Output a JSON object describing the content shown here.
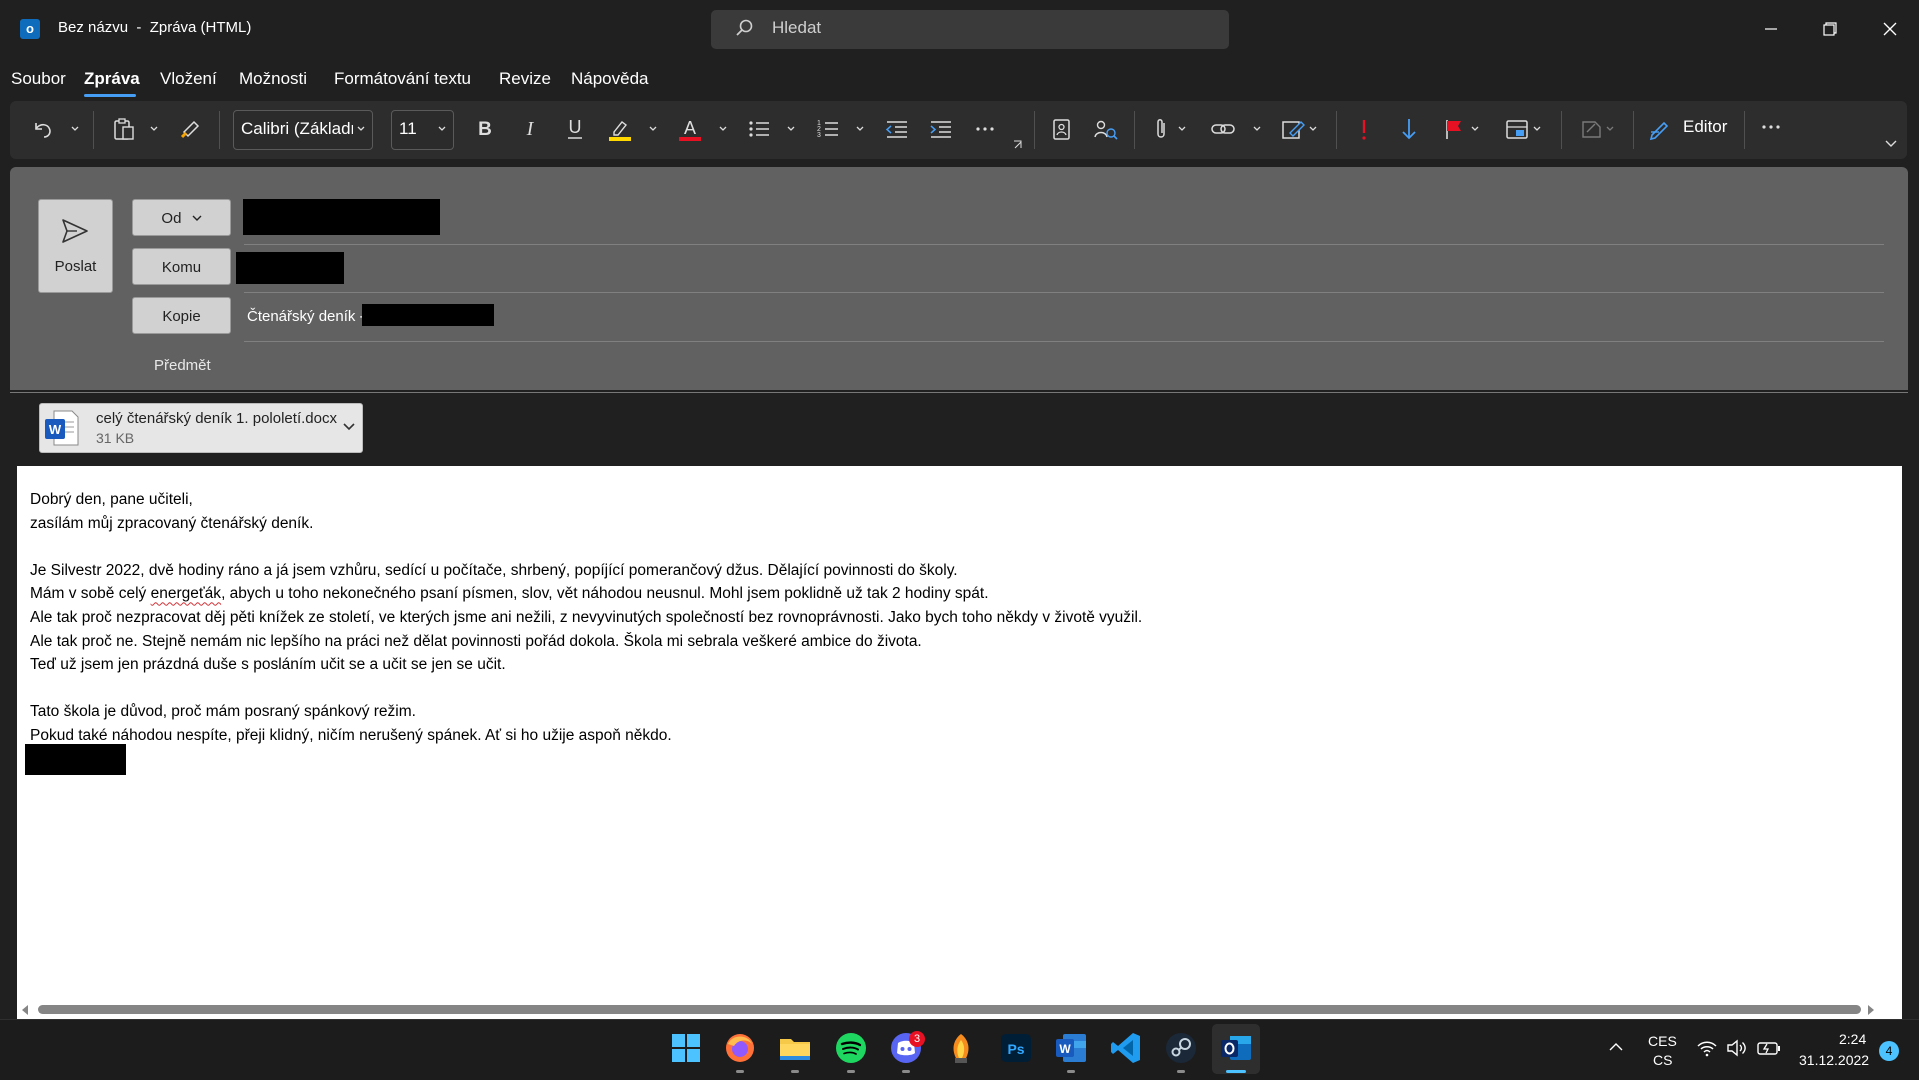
{
  "window": {
    "title": "Bez názvu  -  Zpráva (HTML)",
    "search_placeholder": "Hledat"
  },
  "tabs": [
    "Soubor",
    "Zpráva",
    "Vložení",
    "Možnosti",
    "Formátování textu",
    "Revize",
    "Nápověda"
  ],
  "active_tab": "Zpráva",
  "ribbon": {
    "font_name": "Calibri (Základní",
    "font_size": "11",
    "editor_label": "Editor",
    "highlight_color": "#ffd800",
    "font_color": "#e81123",
    "importance_high_color": "#e81123",
    "importance_low_color": "#479ef5",
    "flag_color": "#e81123"
  },
  "compose": {
    "send_label": "Poslat",
    "from_label": "Od",
    "to_label": "Komu",
    "cc_label": "Kopie",
    "cc_text": "Čtenářský deník - ",
    "subject_label": "Předmět"
  },
  "attachment": {
    "name": "celý čtenářský deník 1. pololetí.docx",
    "size": "31 KB"
  },
  "body": {
    "line1": "Dobrý den, pane učiteli,",
    "line2": "zasílám můj zpracovaný čtenářský deník.",
    "line3": "Je Silvestr 2022, dvě hodiny ráno a já jsem vzhůru, sedící u počítače, shrbený, popíjící pomerančový džus. Dělající povinnosti do školy.",
    "line4a": "Mám v sobě celý ",
    "line4b": "energeťák",
    "line4c": ", abych u toho nekonečného psaní písmen, slov, vět náhodou neusnul. Mohl jsem poklidně už tak 2 hodiny spát.",
    "line5": "Ale tak proč nezpracovat děj pěti knížek ze století, ve kterých jsme ani nežili, z nevyvinutých společností bez rovnoprávnosti. Jako bych toho někdy v životě využil.",
    "line6": "Ale tak proč ne. Stejně nemám nic lepšího na práci než dělat povinnosti pořád dokola. Škola mi sebrala veškeré ambice do života.",
    "line7": "Teď už jsem jen prázdná duše s posláním učit se a učit se jen se učit.",
    "line8": "Tato škola je důvod, proč mám posraný spánkový režim.",
    "line9": "Pokud také náhodou nespíte, přeji klidný, ničím nerušený spánek. Ať si ho užije aspoň někdo."
  },
  "taskbar": {
    "apps": [
      "windows-start",
      "firefox",
      "file-explorer",
      "spotify",
      "discord",
      "fl-studio",
      "photoshop",
      "word",
      "vscode",
      "steam",
      "outlook"
    ],
    "discord_badge": "3",
    "lang_line1": "CES",
    "lang_line2": "CS",
    "time": "2:24",
    "date": "31.12.2022",
    "notification_count": "4"
  }
}
